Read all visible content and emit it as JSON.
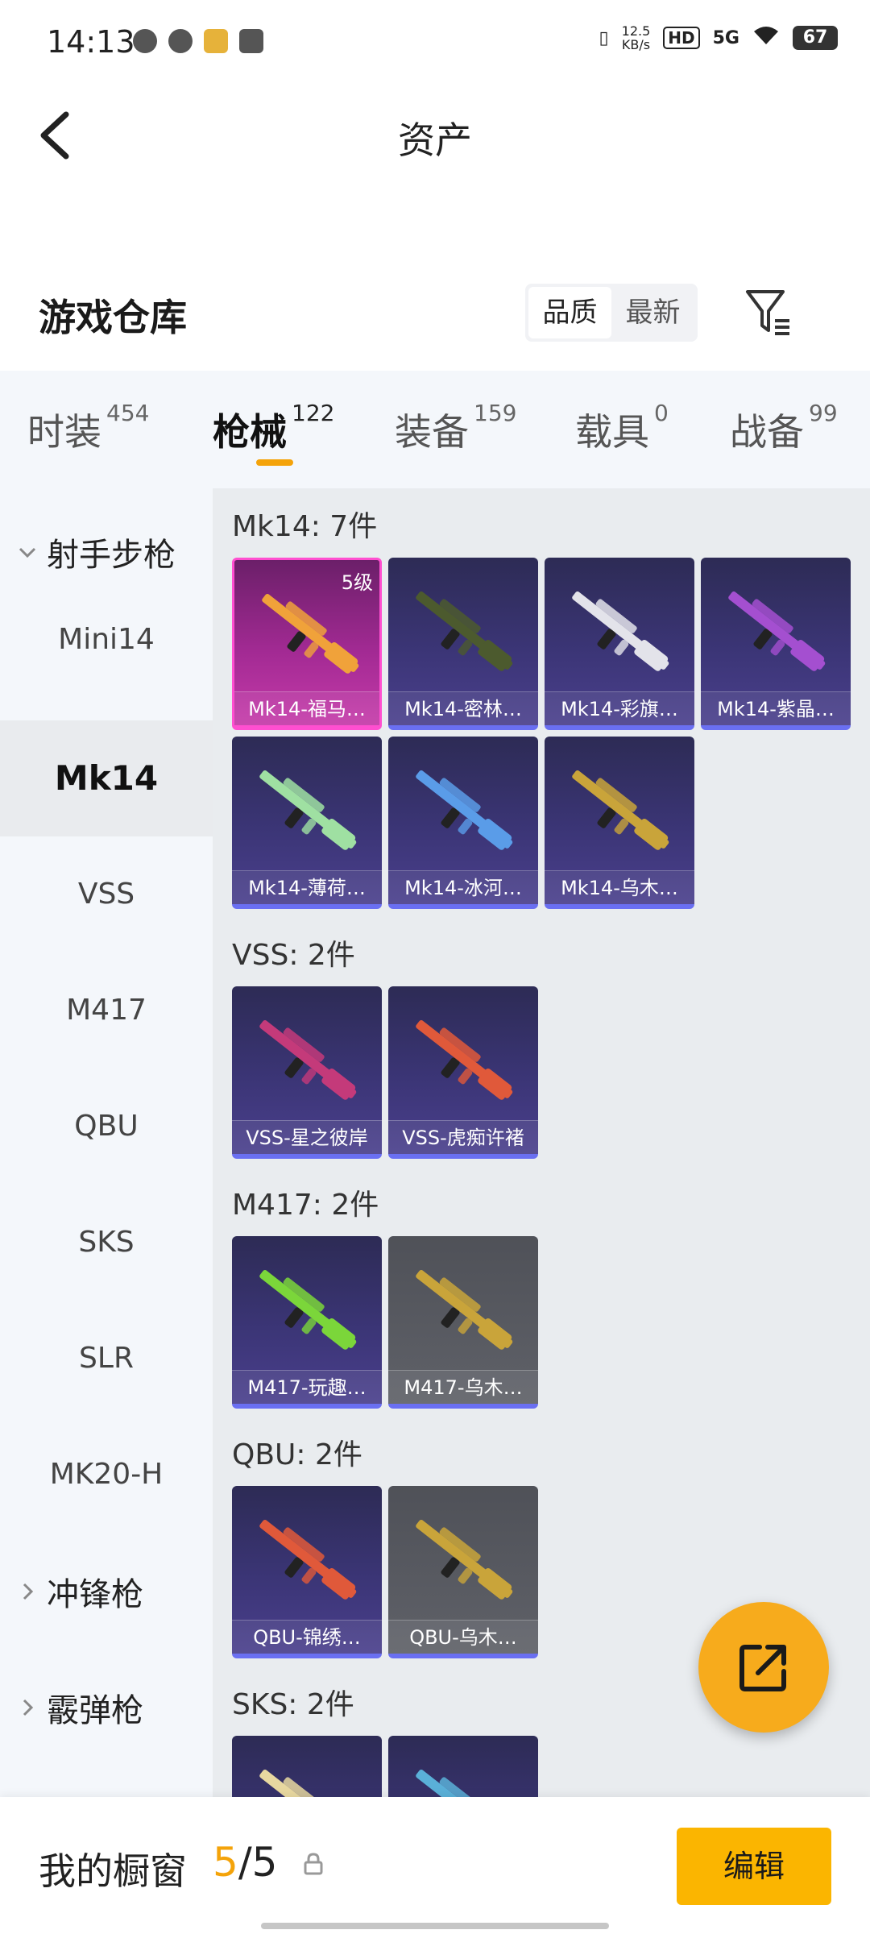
{
  "status_bar": {
    "time": "14:13",
    "net_speed_value": "12.5",
    "net_speed_unit": "KB/s",
    "hd": "HD",
    "signal": "5G",
    "battery": "67"
  },
  "header": {
    "title": "资产"
  },
  "warehouse": {
    "title": "游戏仓库",
    "sort_options": [
      "品质",
      "最新"
    ],
    "sort_selected": "品质"
  },
  "category_tabs": [
    {
      "label": "时装",
      "count": "454"
    },
    {
      "label": "枪械",
      "count": "122"
    },
    {
      "label": "装备",
      "count": "159"
    },
    {
      "label": "载具",
      "count": "0"
    },
    {
      "label": "战备",
      "count": "99"
    }
  ],
  "sidebar": {
    "groups": [
      {
        "label": "射手步枪",
        "expanded": true
      },
      {
        "label": "冲锋枪",
        "expanded": false
      },
      {
        "label": "霰弹枪",
        "expanded": false
      }
    ],
    "items": [
      "Mini14",
      "Mk14",
      "VSS",
      "M417",
      "QBU",
      "SKS",
      "SLR",
      "MK20-H"
    ],
    "active_item": "Mk14"
  },
  "sections": [
    {
      "title": "Mk14: 7件",
      "items": [
        {
          "label": "Mk14-福马…",
          "level": "5级",
          "rarity": "legendary",
          "gun_color": "#f0a23a"
        },
        {
          "label": "Mk14-密林…",
          "rarity": "epic",
          "gun_color": "#4c5a2e"
        },
        {
          "label": "Mk14-彩旗…",
          "rarity": "epic",
          "gun_color": "#e3e3ea"
        },
        {
          "label": "Mk14-紫晶…",
          "rarity": "epic",
          "gun_color": "#a44fd0"
        },
        {
          "label": "Mk14-薄荷…",
          "rarity": "epic",
          "gun_color": "#9fe0a2"
        },
        {
          "label": "Mk14-冰河…",
          "rarity": "epic",
          "gun_color": "#5a9ce8"
        },
        {
          "label": "Mk14-乌木…",
          "rarity": "epic",
          "gun_color": "#c9a43a"
        }
      ]
    },
    {
      "title": "VSS: 2件",
      "items": [
        {
          "label": "VSS-星之彼岸",
          "rarity": "epic",
          "gun_color": "#c43a7a"
        },
        {
          "label": "VSS-虎痴许褚",
          "rarity": "epic",
          "gun_color": "#e0593a"
        }
      ]
    },
    {
      "title": "M417: 2件",
      "items": [
        {
          "label": "M417-玩趣…",
          "rarity": "epic",
          "gun_color": "#7bd63a"
        },
        {
          "label": "M417-乌木…",
          "rarity": "rare",
          "gun_color": "#c9a43a"
        }
      ]
    },
    {
      "title": "QBU: 2件",
      "items": [
        {
          "label": "QBU-锦绣…",
          "rarity": "epic",
          "gun_color": "#e0593a"
        },
        {
          "label": "QBU-乌木…",
          "rarity": "rare",
          "gun_color": "#c9a43a"
        }
      ]
    },
    {
      "title": "SKS: 2件",
      "items": [
        {
          "label": "",
          "rarity": "epic",
          "gun_color": "#e8d8a0"
        },
        {
          "label": "",
          "rarity": "epic",
          "gun_color": "#5ab0d8"
        }
      ]
    }
  ],
  "bottom_bar": {
    "showcase_label": "我的橱窗",
    "showcase_current": "5",
    "showcase_separator": "/",
    "showcase_total": "5",
    "edit_label": "编辑"
  },
  "colors": {
    "accent": "#f4a30a",
    "edit_button": "#fbb500",
    "fab": "#f7ab1c",
    "epic_border": "#6a6ff2",
    "legendary_border": "#f04ac4"
  }
}
